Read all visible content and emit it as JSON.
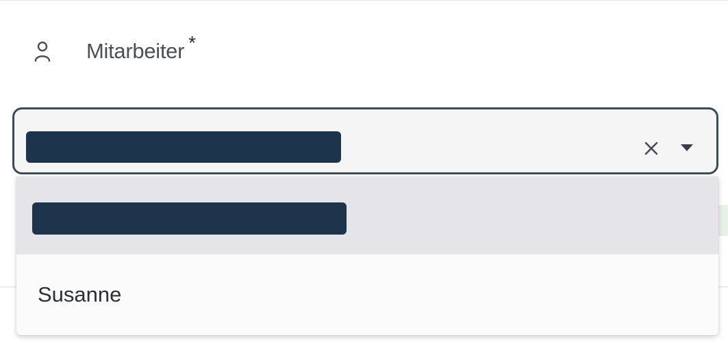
{
  "field": {
    "label": "Mitarbeiter",
    "required_marker": "*",
    "icon": "person-icon"
  },
  "select": {
    "selected_value_redacted": true,
    "clear_icon": "close-icon",
    "toggle_icon": "caret-down-icon"
  },
  "dropdown": {
    "options": [
      {
        "label": "",
        "redacted": true,
        "highlighted": true
      },
      {
        "label": "Susanne",
        "redacted": false,
        "highlighted": false
      }
    ]
  },
  "colors": {
    "redaction": "#1e344c",
    "select_border": "#3b4a55",
    "highlight": "#e5e5e9",
    "label_text": "#4a4f57"
  }
}
